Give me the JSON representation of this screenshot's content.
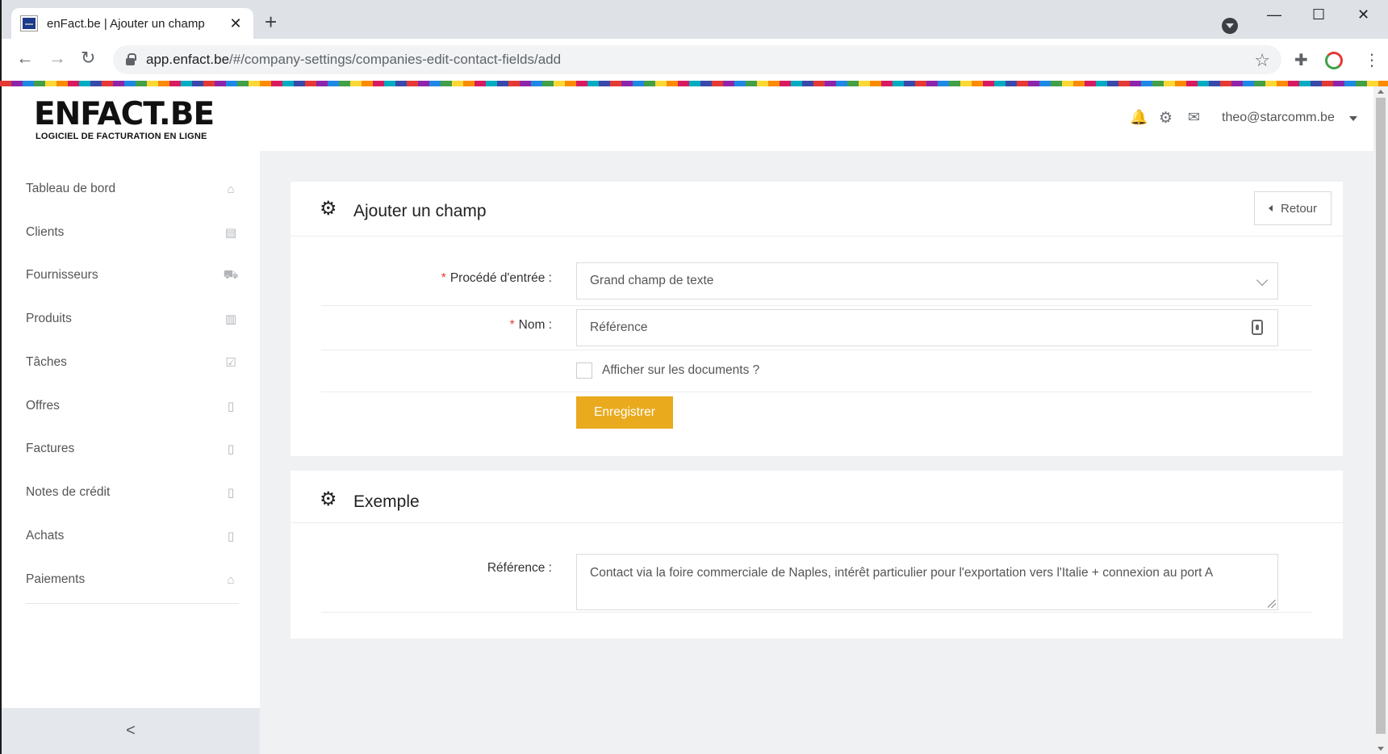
{
  "browser": {
    "tab_title": "enFact.be | Ajouter un champ",
    "tab_close": "✕",
    "new_tab": "+",
    "url_host": "app.enfact.be",
    "url_path": "/#/company-settings/companies-edit-contact-fields/add",
    "win_minimize": "—",
    "win_maximize": "☐",
    "win_close": "✕",
    "back": "←",
    "forward": "→",
    "reload": "↻",
    "star": "☆",
    "extensions": "✚",
    "menu": "⋮"
  },
  "header": {
    "logo": "ENFACT.BE",
    "logo_sub": "LOGICIEL DE FACTURATION EN LIGNE",
    "bell": "🔔",
    "settings": "⚙",
    "mail": "✉",
    "user_email": "theo@starcomm.be"
  },
  "sidebar": {
    "items": [
      {
        "label": "Tableau de bord",
        "icon": "⌂"
      },
      {
        "label": "Clients",
        "icon": "▤"
      },
      {
        "label": "Fournisseurs",
        "icon": "⛟"
      },
      {
        "label": "Produits",
        "icon": "▥"
      },
      {
        "label": "Tâches",
        "icon": "☑"
      },
      {
        "label": "Offres",
        "icon": "▯"
      },
      {
        "label": "Factures",
        "icon": "▯"
      },
      {
        "label": "Notes de crédit",
        "icon": "▯"
      },
      {
        "label": "Achats",
        "icon": "▯"
      },
      {
        "label": "Paiements",
        "icon": "⌂"
      }
    ],
    "collapse": "<"
  },
  "form_card": {
    "title": "Ajouter un champ",
    "gear": "⚙",
    "back_label": "Retour",
    "input_method_label": "Procédé d'entrée :",
    "input_method_value": "Grand champ de texte",
    "name_label": "Nom :",
    "name_value": "Référence",
    "required_mark": "*",
    "show_on_docs_label": "Afficher sur les documents ?",
    "save_label": "Enregistrer"
  },
  "example_card": {
    "title": "Exemple",
    "gear": "⚙",
    "field_label": "Référence :",
    "field_value": "Contact via la foire commerciale de Naples, intérêt particulier pour l'exportation vers l'Italie + connexion au port A"
  }
}
